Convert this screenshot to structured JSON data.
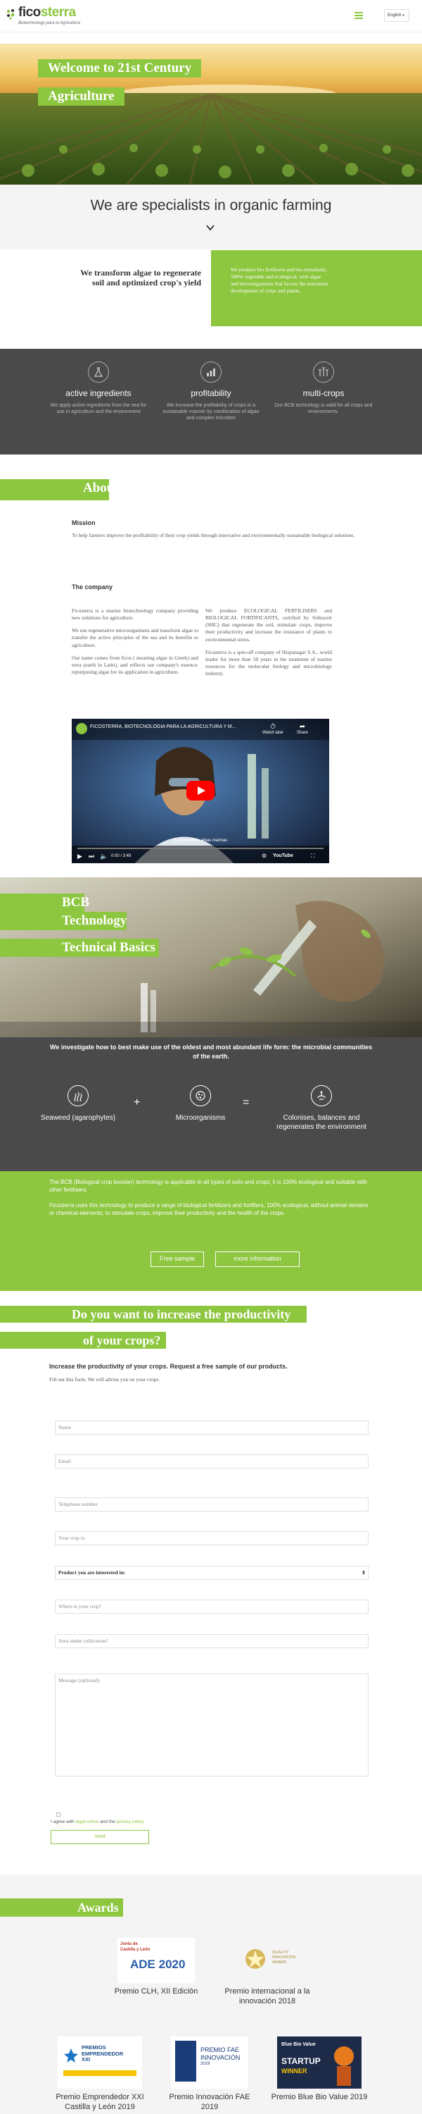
{
  "header": {
    "logo_prefix": "fico",
    "logo_suffix": "sterra",
    "tagline": "Biotechnology para la Agricultura",
    "language": "English",
    "menu_icon": "hamburger-icon"
  },
  "hero": {
    "title_line1": "Welcome to 21st Century",
    "title_line2": "Agriculture"
  },
  "specialists": {
    "title": "We are specialists in organic farming",
    "icon": "chevron-down-icon"
  },
  "transform": {
    "left_text": "We transform algae to regenerate soil and optimized crop's yield",
    "right_text": "We produce bio fertilisers and bio-stimulants, 100% vegetable and ecological, with algae and microorganisms that favour the maximum development of crops and plants."
  },
  "features": [
    {
      "icon": "leaf-flask-icon",
      "title": "active ingredients",
      "text": "We apply active ingredients from the sea for use in agriculture and the environment"
    },
    {
      "icon": "chart-icon",
      "title": "profitability",
      "text": "We increase the profitability of crops in a sustainable manner by combination of algae and complex microbes"
    },
    {
      "icon": "crops-icon",
      "title": "multi-crops",
      "text": "Our BCB technology is valid for all crops and environments."
    }
  ],
  "about": {
    "title": "About us",
    "mission_title": "Mission",
    "mission_text": "To help farmers improve the profitability of their crop yields through innovative and environmentally sustainable biological solutions.",
    "company_title": "The company",
    "col1_p1": "Ficosterra is a marine biotechnology company providing new solutions for agriculture.",
    "col1_p2": "We use regenerative microorganisms and transform algae to transfer the active principles of the sea and its benefits to agriculture.",
    "col1_p3": "Our name comes from ficos ( meaning algae in Greek) and terra (earth in Latin), and reflects our company's essence: repurposing algae for its application in agriculture.",
    "col2_p1": "We produce ECOLOGICAL FERTILISERS and BIOLOGICAL FORTIFICANTS, certified by Sohiscert (SHC) that regenerate the soil, stimulate crops, improve their productivity and increase the resistance of plants to environmental stress.",
    "col2_p2": "Ficosterra is a spin-off company of Hispanagar S.A., world leader for more than 50 years in the treatment of marine resources for the molecular biology and microbiology industry."
  },
  "video": {
    "title": "FICOSTERRA, BIOTECNOLOGÍA PARA LA AGRICULTURA Y M...",
    "watch_later": "Watch later",
    "share": "Share",
    "time": "0:00 / 3:49",
    "caption": "En Ficosterra, algas marinas",
    "platform": "YouTube"
  },
  "bcb": {
    "title_line1": "BCB",
    "title_line2": "Technology",
    "subtitle": "Technical Basics"
  },
  "microbial": {
    "title": "We investigate how to best make use of the oldest and most abundant life form: the microbial communities of the earth.",
    "items": [
      {
        "icon": "seaweed-icon",
        "label": "Seaweed (agarophytes)"
      },
      {
        "icon": "microorganisms-icon",
        "label": "Microorganisms"
      },
      {
        "icon": "balance-icon",
        "label": "Colonises, balances and regenerates the environment"
      }
    ],
    "plus": "+",
    "equals": "="
  },
  "bcb_info": {
    "p1": "The BCB (Biological crop booster) technology is applicable to all types of soils and crops; it is 100% ecological and suitable with other fertilisers.",
    "p2": "Ficosterra uses this technology to produce a range of biological fertilizers and fortifiers, 100% ecological, without animal remains or chemical elements, to stimulate crops, improve their productivity and the health of the crops.",
    "btn_sample": "Free sample",
    "btn_info": "more information"
  },
  "productivity": {
    "title_line1": "Do you want to increase the productivity",
    "title_line2": "of your crops?",
    "subtitle": "Increase the productivity of your crops. Request a free sample of our products.",
    "fill_text": "Fill out this form. We will advise you on your crops."
  },
  "form": {
    "name": "Name",
    "email": "Email",
    "telephone": "Telephone number",
    "crop": "Your crop is:",
    "product": "Product you are interested in:",
    "where": "Where is your crop?",
    "area": "Area under cultivation?",
    "message": "Message (optional):",
    "agree_prefix": "I agree with ",
    "legal": "legal notice",
    "and": " and the ",
    "privacy": "privacy policy",
    "send": "send"
  },
  "awards": {
    "title": "Awards",
    "items": [
      {
        "logo_lines": [
          "Junta de",
          "Castilla y León"
        ],
        "logo_main": "ADE 2020",
        "caption": "Premio CLH, XII Edición"
      },
      {
        "logo_lines": [
          "QUALITY",
          "INNOVATION",
          "AWARD"
        ],
        "logo_main": "",
        "caption": "Premio internacional a la innovación 2018"
      },
      {
        "logo_lines": [
          "PREMIOS",
          "EMPRENDEDOR",
          "XXI"
        ],
        "logo_main": "",
        "caption": "Premio Emprendedor XXI Castilla y León 2019"
      },
      {
        "logo_lines": [
          "PREMIO FAE",
          "INNOVACIÓN",
          "2019"
        ],
        "logo_main": "",
        "caption": "Premio Innovación FAE 2019"
      },
      {
        "logo_lines": [
          "Blue Bio Value",
          "STARTUP",
          "WINNER"
        ],
        "logo_main": "",
        "caption": "Premio Blue Bio Value 2019"
      }
    ]
  },
  "colors": {
    "brand_green": "#8dc63f",
    "dark_grey": "#4a4a4a",
    "light_grey": "#f4f4f4"
  }
}
